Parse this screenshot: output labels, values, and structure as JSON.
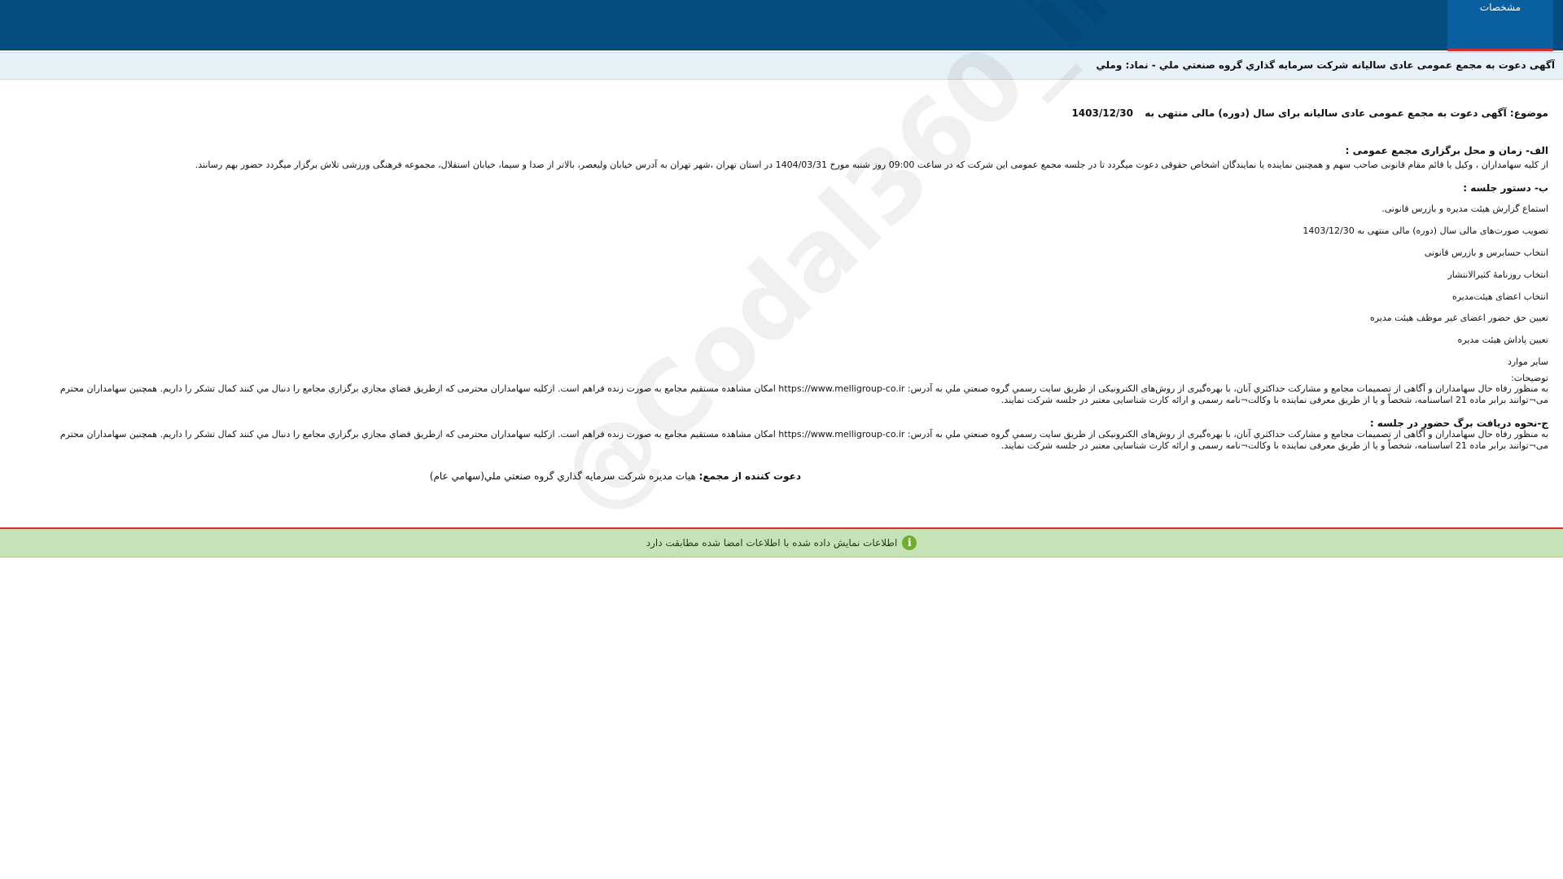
{
  "header": {
    "tab_label": "مشخصات"
  },
  "title": "آگهی دعوت به مجمع عمومی عادی سالیانه شرکت سرمایه گذاري گروه صنعتي ملي - نماد: وملي",
  "subject": {
    "label": "موضوع: آگهی دعوت به مجمع عمومی عادی سالیانه برای سال (دوره) مالی منتهی به",
    "date": "1403/12/30"
  },
  "section_a": {
    "heading": "الف- زمان و محل برگزاری مجمع عمومی :",
    "text": "از کلیه سهامداران ، وکیل یا قائم مقام قانونی صاحب سهم و همچنین نماینده یا نمایندگان اشخاص حقوقی دعوت میگردد تا در جلسه مجمع عمومی این شرکت که در ساعت 09:00 روز شنبه مورخ 1404/03/31 در استان تهران ،شهر تهران به آدرس خیابان ولیعصر، بالاتر از صدا و سیما، خیابان استقلال، مجموعه فرهنگی ورزشی تلاش برگزار میگردد حضور بهم رسانند."
  },
  "section_b": {
    "heading": "ب- دستور جلسه :",
    "items": [
      "استماع گزارش هیئت مدیره و بازرس قانونی.",
      "تصویب صورت‌های مالی سال (دوره) مالی منتهی به 1403/12/30",
      "انتخاب حسابرس و بازرس قانونی",
      "انتخاب روزنامۀ کثیرالانتشار",
      "انتخاب اعضای هیئت‌مدیره",
      "تعیین حق حضور اعضای غیر موظف هیئت مدیره",
      "تعیین پاداش هیئت مدیره",
      "سایر موارد"
    ],
    "notes_label": "توضیحات:",
    "notes_text": "به منظور رفاه حال سهامداران و آگاهی از تصمیمات مجامع و مشارکت حداکثري آنان، با بهره‌گیری از روش‌های الکترونیکی از طریق سایت رسمي گروه صنعتي ملي به آدرس: https://www.melligroup-co.ir امکان مشاهده مستقیم مجامع به صورت زنده فراهم است. ازکلیه سهامداران محترمی که ازطریق فضاي مجازي برگزاري مجامع را دنبال مي کنند کمال تشکر را داریم. همچنین سهامداران محترم می¬توانند برابر ماده 21 اساسنامه، شخصاً و یا از طریق معرفی نماینده با وکالت¬نامه رسمی و ارائه کارت شناسایی معتبر در جلسه شرکت نمایند."
  },
  "section_c": {
    "heading": "ج-نحوه دریافت برگ حضور در جلسه :",
    "text": "به منظور رفاه حال سهامداران و آگاهی از تصمیمات مجامع و مشارکت حداکثري آنان، با بهره‌گیری از روش‌های الکترونیکی از طریق سایت رسمي گروه صنعتي ملي به آدرس: https://www.melligroup-co.ir امکان مشاهده مستقیم مجامع به صورت زنده فراهم است. ازکلیه سهامداران محترمی که ازطریق فضاي مجازي برگزاري مجامع را دنبال مي کنند کمال تشکر را داریم. همچنین سهامداران محترم می¬توانند برابر ماده 21 اساسنامه، شخصاً و یا از طریق معرفی نماینده با وکالت¬نامه رسمی و ارائه کارت شناسایی معتبر در جلسه شرکت نمایند."
  },
  "inviter": {
    "label": "دعوت کننده از مجمع:",
    "value": "هیات مدیره شرکت سرمایه گذاري گروه صنعتي ملي(سهامي عام)"
  },
  "watermark": "@Codal360_ir",
  "status": {
    "icon": "info-icon",
    "text": "اطلاعات نمایش داده شده با اطلاعات امضا شده مطابقت دارد"
  }
}
